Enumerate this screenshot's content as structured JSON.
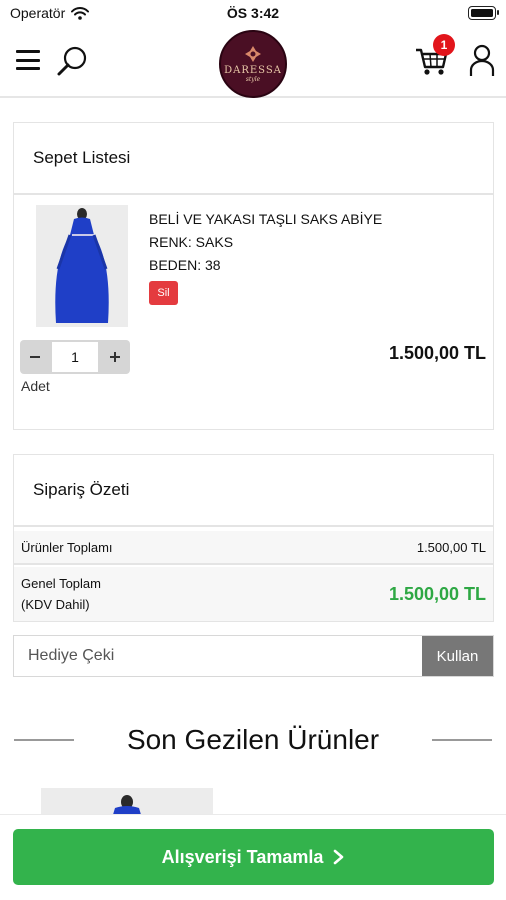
{
  "status_bar": {
    "carrier": "Operatör",
    "time": "ÖS 3:42"
  },
  "header": {
    "logo_text": "DARESSA",
    "logo_sub": "style",
    "cart_count": "1",
    "icons": [
      "menu-icon",
      "search-icon",
      "cart-icon",
      "user-icon"
    ]
  },
  "cart": {
    "title": "Sepet Listesi",
    "item": {
      "name": "BELİ VE YAKASI TAŞLI SAKS ABİYE",
      "color_line": "RENK: SAKS",
      "size_line": "BEDEN: 38",
      "delete_label": "Sil",
      "quantity": "1",
      "quantity_label": "Adet",
      "price": "1.500,00 TL"
    }
  },
  "summary": {
    "title": "Sipariş Özeti",
    "subtotal_label": "Ürünler Toplamı",
    "subtotal_value": "1.500,00 TL",
    "total_label": "Genel Toplam",
    "total_note": "(KDV Dahil)",
    "total_value": "1.500,00 TL"
  },
  "coupon": {
    "placeholder": "Hediye Çeki",
    "button_label": "Kullan"
  },
  "recent": {
    "title": "Son Gezilen Ürünler"
  },
  "checkout": {
    "label": "Alışverişi Tamamla",
    "icon": "chevron-right-icon"
  },
  "colors": {
    "accent_green": "#33b34c",
    "total_green": "#2ea844",
    "delete_red": "#e43b3f",
    "badge_red": "#e2151b",
    "logo_bg": "#4a0f24",
    "dress_blue": "#1f3fc7"
  }
}
